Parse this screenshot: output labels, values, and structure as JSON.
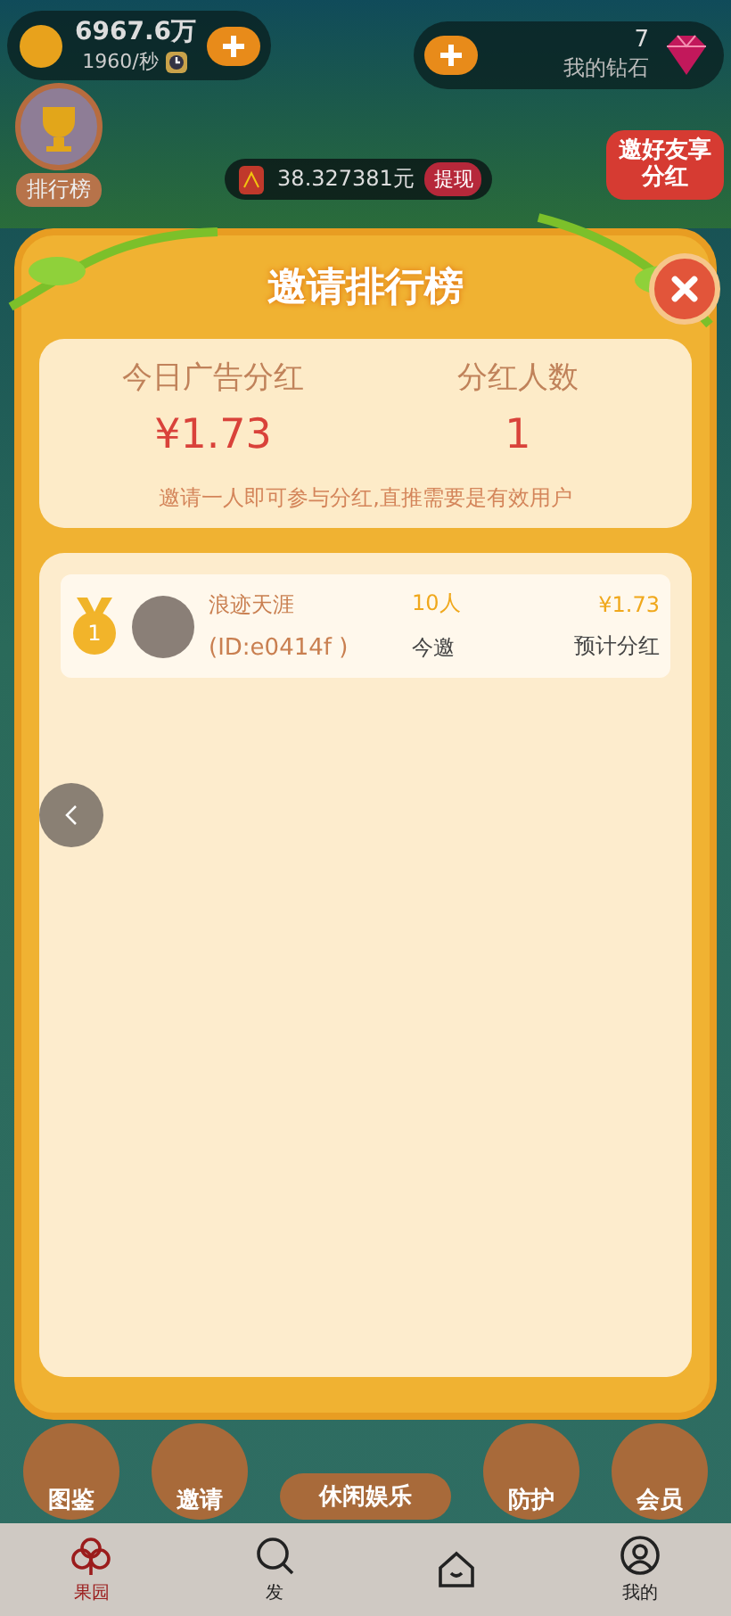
{
  "hud": {
    "coins": "6967.6万",
    "rate": "1960/秒",
    "diamonds": "7",
    "diamond_label": "我的钻石",
    "rank_label": "排行榜",
    "cash": "38.327381元",
    "withdraw": "提现",
    "promo": "邀好友享分红"
  },
  "modal": {
    "title": "邀请排行榜",
    "stats": [
      {
        "label": "今日广告分红",
        "value": "¥1.73"
      },
      {
        "label": "分红人数",
        "value": "1"
      }
    ],
    "note": "邀请一人即可参与分红,直推需要是有效用户",
    "rows": [
      {
        "rank": "1",
        "name": "浪迹天涯",
        "id": "(ID:e0414f )",
        "count": "10人",
        "count_label": "今邀",
        "amount": "¥1.73",
        "amount_label": "预计分红"
      }
    ]
  },
  "game_buttons": [
    {
      "label": "图鉴"
    },
    {
      "label": "邀请"
    },
    {
      "label": "休闲娱乐"
    },
    {
      "label": "防护"
    },
    {
      "label": "会员"
    }
  ],
  "tabs": [
    {
      "label": "果园",
      "selected": true
    },
    {
      "label": "发",
      "selected": false
    },
    {
      "selected": false
    },
    {
      "label": "我的",
      "selected": false
    }
  ]
}
